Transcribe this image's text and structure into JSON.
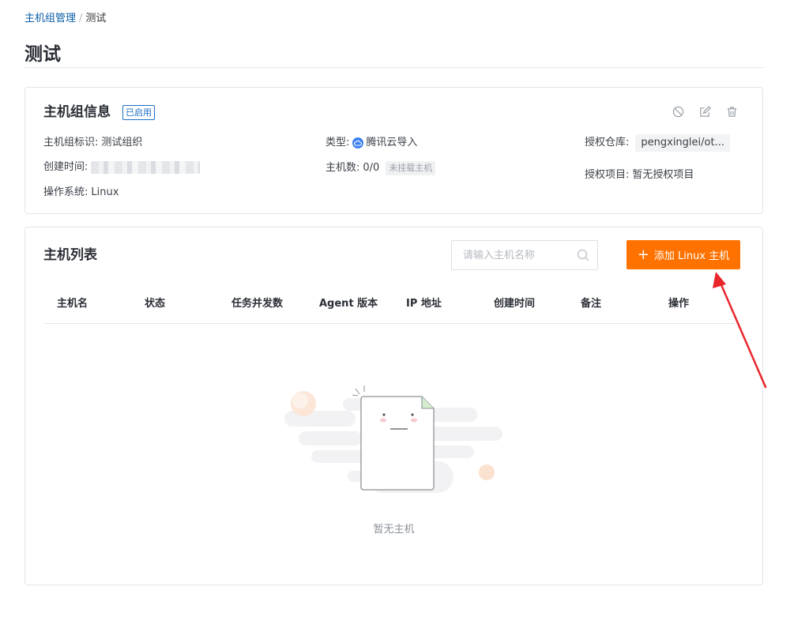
{
  "breadcrumb": {
    "parent": "主机组管理",
    "separator": "/",
    "current": "测试"
  },
  "page": {
    "title": "测试"
  },
  "group_info": {
    "title": "主机组信息",
    "status_badge": "已启用",
    "actions": [
      {
        "name": "disable",
        "icon": "ban-icon"
      },
      {
        "name": "edit",
        "icon": "edit-icon"
      },
      {
        "name": "delete",
        "icon": "trash-icon"
      }
    ],
    "fields": {
      "identifier_label": "主机组标识:",
      "identifier_value": "测试组织",
      "created_label": "创建时间:",
      "os_label": "操作系统:",
      "os_value": "Linux",
      "type_label": "类型:",
      "type_value": "腾讯云导入",
      "host_count_label": "主机数:",
      "host_count_value": "0/0",
      "host_count_tag": "未挂载主机",
      "repo_label": "授权仓库:",
      "repo_value": "pengxinglei/ot...",
      "project_label": "授权项目:",
      "project_value": "暂无授权项目"
    }
  },
  "host_list": {
    "title": "主机列表",
    "search_placeholder": "请输入主机名称",
    "add_button_label": "添加 Linux 主机",
    "columns": [
      "主机名",
      "状态",
      "任务并发数",
      "Agent 版本",
      "IP 地址",
      "创建时间",
      "备注",
      "操作"
    ],
    "empty_text": "暂无主机"
  },
  "colors": {
    "primary_button": "#ff7200",
    "link": "#0b5ea8",
    "badge": "#1e6fc7",
    "annotation": "#e8262c"
  }
}
